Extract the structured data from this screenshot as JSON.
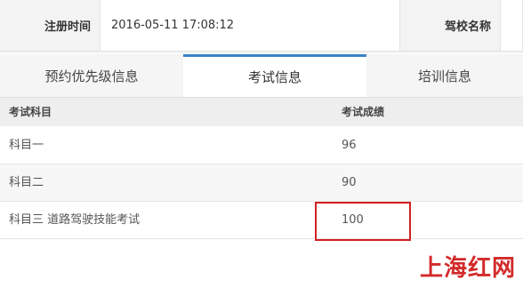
{
  "info": {
    "reg_time_label": "注册时间",
    "reg_time_value": "2016-05-11 17:08:12",
    "school_label": "驾校名称",
    "school_value": ""
  },
  "tabs": [
    {
      "label": "预约优先级信息",
      "active": false
    },
    {
      "label": "考试信息",
      "active": true
    },
    {
      "label": "培训信息",
      "active": false
    }
  ],
  "table": {
    "headers": [
      "考试科目",
      "考试成绩"
    ],
    "rows": [
      {
        "subject": "科目一",
        "score": "96"
      },
      {
        "subject": "科目二",
        "score": "90"
      },
      {
        "subject": "科目三 道路驾驶技能考试",
        "score": "100"
      }
    ]
  },
  "colors": {
    "accent": "#3a83c8",
    "highlight": "#d22020"
  },
  "watermark": "上海红网"
}
